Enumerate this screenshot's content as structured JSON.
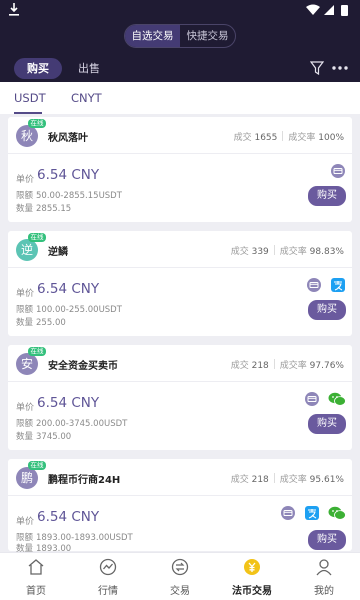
{
  "header": {
    "segments": [
      "自选交易",
      "快捷交易"
    ],
    "tab_buy": "购买",
    "tab_sell": "出售",
    "filter_icon": "filter-icon",
    "more_icon": "more-dots-icon"
  },
  "currency_tabs": [
    "USDT",
    "CNYT"
  ],
  "labels": {
    "online": "在线",
    "trades": "成交",
    "rate": "成交率",
    "unit_price": "单价",
    "limit": "限额",
    "quantity": "数量",
    "buy": "购买"
  },
  "cards": [
    {
      "avatar": "秋",
      "avatar_color": "#8e86b8",
      "name": "秋风落叶",
      "trades": "1655",
      "rate": "100%",
      "price": "6.54 CNY",
      "limit": "50.00-2855.15USDT",
      "quantity": "2855.15",
      "payments": [
        "bank-card-icon"
      ]
    },
    {
      "avatar": "逆",
      "avatar_color": "#5cc4b4",
      "name": "逆鳞",
      "trades": "339",
      "rate": "98.83%",
      "price": "6.54 CNY",
      "limit": "100.00-255.00USDT",
      "quantity": "255.00",
      "payments": [
        "bank-card-icon",
        "alipay-icon"
      ]
    },
    {
      "avatar": "安",
      "avatar_color": "#8e86b8",
      "name": "安全资金买卖币",
      "trades": "218",
      "rate": "97.76%",
      "price": "6.54 CNY",
      "limit": "200.00-3745.00USDT",
      "quantity": "3745.00",
      "payments": [
        "bank-card-icon",
        "wechat-icon"
      ]
    },
    {
      "avatar": "鹏",
      "avatar_color": "#8e86b8",
      "name": "鹏程币行商24H",
      "trades": "218",
      "rate": "95.61%",
      "price": "6.54 CNY",
      "limit": "1893.00-1893.00USDT",
      "quantity": "1893.00",
      "payments": [
        "bank-card-icon",
        "alipay-icon",
        "wechat-icon"
      ]
    }
  ],
  "nav": [
    {
      "label": "首页",
      "icon": "home-icon"
    },
    {
      "label": "行情",
      "icon": "market-icon"
    },
    {
      "label": "交易",
      "icon": "exchange-icon"
    },
    {
      "label": "法币交易",
      "icon": "fiat-coin-icon",
      "active": true
    },
    {
      "label": "我的",
      "icon": "user-icon"
    }
  ],
  "colors": {
    "header_bg": "#1f1b33",
    "accent": "#554b88",
    "online": "#33c07c",
    "alipay": "#1da0f2",
    "wechat": "#3cb034"
  }
}
